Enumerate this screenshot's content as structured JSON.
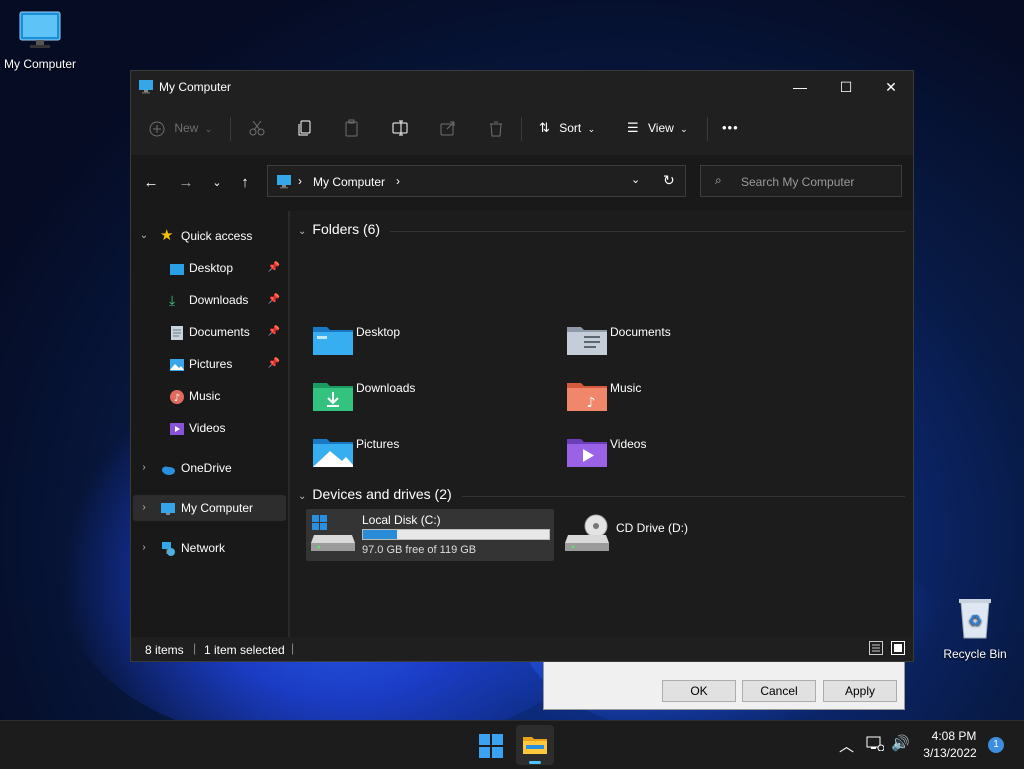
{
  "desktop": {
    "icons": [
      {
        "label": "My Computer"
      },
      {
        "label": "Recycle Bin"
      }
    ]
  },
  "background_dialog": {
    "ok_label": "OK",
    "cancel_label": "Cancel",
    "apply_label": "Apply"
  },
  "window": {
    "title": "My Computer",
    "controls": {
      "minimize": "—",
      "maximize": "☐",
      "close": "✕"
    }
  },
  "commandbar": {
    "new_label": "New",
    "sort_label": "Sort",
    "view_label": "View",
    "more_label": "•••"
  },
  "address": {
    "path": "My Computer",
    "separator": "›",
    "search_placeholder": "Search My Computer"
  },
  "navpane": {
    "quick_access": "Quick access",
    "items": [
      {
        "label": "Desktop",
        "pinned": true
      },
      {
        "label": "Downloads",
        "pinned": true
      },
      {
        "label": "Documents",
        "pinned": true
      },
      {
        "label": "Pictures",
        "pinned": true
      },
      {
        "label": "Music",
        "pinned": false
      },
      {
        "label": "Videos",
        "pinned": false
      }
    ],
    "onedrive": "OneDrive",
    "my_computer": "My Computer",
    "network": "Network"
  },
  "content": {
    "folders_header": "Folders (6)",
    "folders": [
      {
        "label": "Desktop"
      },
      {
        "label": "Documents"
      },
      {
        "label": "Downloads"
      },
      {
        "label": "Music"
      },
      {
        "label": "Pictures"
      },
      {
        "label": "Videos"
      }
    ],
    "drives_header": "Devices and drives (2)",
    "drives": [
      {
        "label": "Local Disk (C:)",
        "free_text": "97.0 GB free of 119 GB",
        "used_fraction": 0.185
      },
      {
        "label": "CD Drive (D:)"
      }
    ]
  },
  "status": {
    "items": "8 items",
    "selected": "1 item selected"
  },
  "taskbar": {
    "time": "4:08 PM",
    "date": "3/13/2022",
    "notification_count": "1"
  },
  "colors": {
    "accent": "#2a8bd6",
    "window_bg": "#202020",
    "taskbar_bg": "#1c1c1c"
  }
}
